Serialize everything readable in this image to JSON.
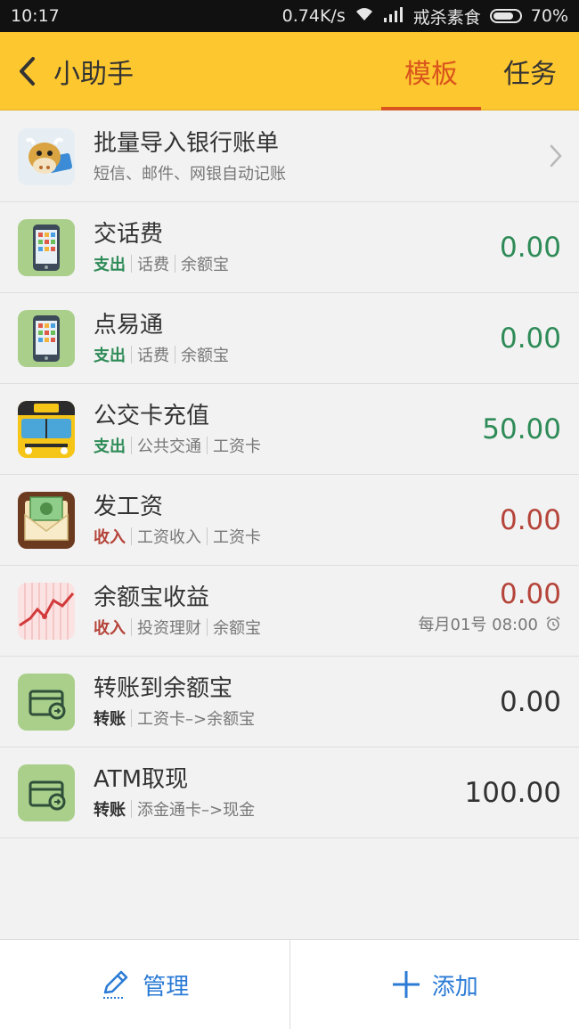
{
  "status": {
    "time": "10:17",
    "speed": "0.74K/s",
    "carrier": "戒杀素食",
    "battery": "70%"
  },
  "appbar": {
    "title": "小助手",
    "tabs": [
      {
        "label": "模板",
        "active": true
      },
      {
        "label": "任务",
        "active": false
      }
    ]
  },
  "items": [
    {
      "name": "批量导入银行账单",
      "sub": "短信、邮件、网银自动记账"
    },
    {
      "name": "交话费",
      "type": "支出",
      "category": "话费",
      "account": "余额宝",
      "amount": "0.00"
    },
    {
      "name": "点易通",
      "type": "支出",
      "category": "话费",
      "account": "余额宝",
      "amount": "0.00"
    },
    {
      "name": "公交卡充值",
      "type": "支出",
      "category": "公共交通",
      "account": "工资卡",
      "amount": "50.00"
    },
    {
      "name": "发工资",
      "type": "收入",
      "category": "工资收入",
      "account": "工资卡",
      "amount": "0.00"
    },
    {
      "name": "余额宝收益",
      "type": "收入",
      "category": "投资理财",
      "account": "余额宝",
      "amount": "0.00",
      "schedule": "每月01号 08:00"
    },
    {
      "name": "转账到余额宝",
      "type": "转账",
      "detail": "工资卡–>余额宝",
      "amount": "0.00"
    },
    {
      "name": "ATM取现",
      "type": "转账",
      "detail": "添金通卡–>现金",
      "amount": "100.00"
    }
  ],
  "bottom": {
    "manage": "管理",
    "add": "添加"
  },
  "colors": {
    "appbar": "#fdc72f",
    "tab_active": "#d9541e",
    "expense": "#2e8b57",
    "income": "#b5443a",
    "action": "#2b7bd6"
  }
}
